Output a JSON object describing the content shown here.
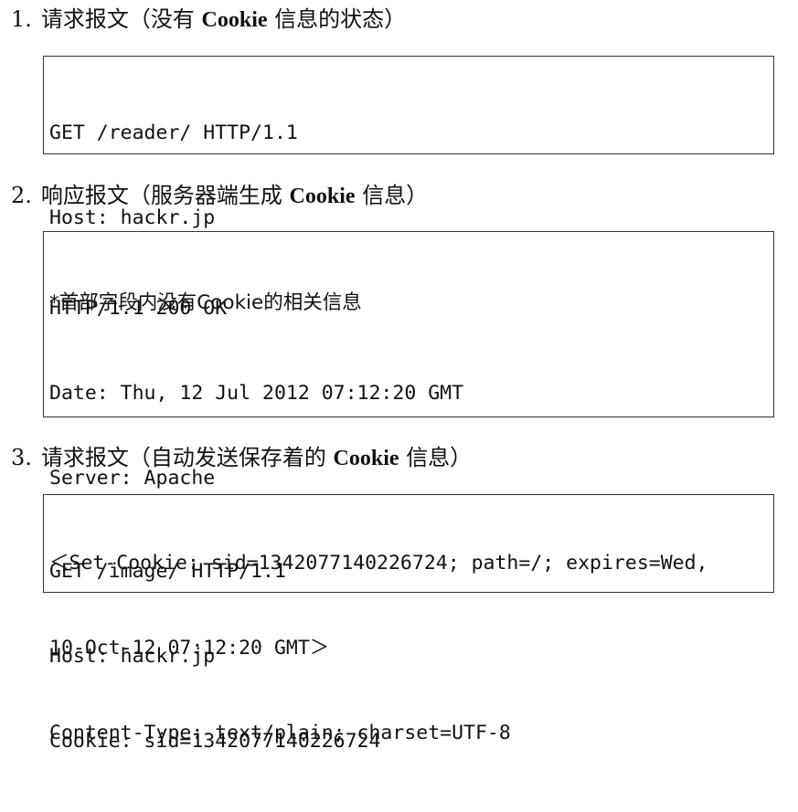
{
  "steps": [
    {
      "number": "1.",
      "title_before": "请求报文（没有",
      "title_bold": "Cookie",
      "title_after": "信息的状态）",
      "lines": [
        "GET /reader/ HTTP/1.1",
        "Host: hackr.jp",
        "*首部字段内没有Cookie的相关信息"
      ]
    },
    {
      "number": "2.",
      "title_before": "响应报文（服务器端生成",
      "title_bold": "Cookie",
      "title_after": "信息）",
      "lines": [
        "HTTP/1.1 200 OK",
        "Date: Thu, 12 Jul 2012 07:12:20 GMT",
        "Server: Apache",
        "＜Set-Cookie: sid=1342077140226724; path=/; expires=Wed,",
        "10-Oct-12 07:12:20 GMT＞",
        "Content-Type: text/plain; charset=UTF-8"
      ]
    },
    {
      "number": "3.",
      "title_before": "请求报文（自动发送保存着的",
      "title_bold": "Cookie",
      "title_after": "信息）",
      "lines": [
        "GET /image/ HTTP/1.1",
        "Host: hackr.jp",
        "Cookie: sid=1342077140226724"
      ]
    }
  ]
}
